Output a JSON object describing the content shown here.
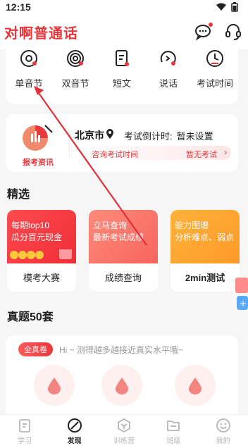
{
  "status_bar": {
    "time": "12:15"
  },
  "header": {
    "brand": "对啊普通话"
  },
  "categories": [
    {
      "label": "单音节",
      "icon": "single-syllable-icon"
    },
    {
      "label": "双音节",
      "icon": "double-syllable-icon"
    },
    {
      "label": "短文",
      "icon": "short-text-icon"
    },
    {
      "label": "说话",
      "icon": "speaking-icon"
    },
    {
      "label": "考试时间",
      "icon": "exam-time-icon"
    }
  ],
  "info_card": {
    "logo_caption": "报考资讯",
    "city": "北京市",
    "countdown_label": "考试倒计时:",
    "countdown_value": "暂未设置",
    "pill_left": "咨询考试时间",
    "pill_right": "暂无考试"
  },
  "featured": {
    "title": "精选",
    "cards": [
      {
        "top_line1": "每期top10",
        "top_line2": "瓜分百元现金",
        "label": "模考大赛"
      },
      {
        "top_line1": "立马查询",
        "top_line2": "最新考试成绩",
        "label": "成绩查询"
      },
      {
        "top_line1": "能力图谱",
        "top_line2": "分析难点、弱点",
        "label": "2min测试"
      }
    ]
  },
  "real_exams": {
    "title": "真题50套",
    "tag": "全真卷",
    "tagline": "Hi ~ 测得越多越接近真实水平哦~"
  },
  "bottom_nav": [
    {
      "label": "学习",
      "icon": "study-icon",
      "active": false
    },
    {
      "label": "发现",
      "icon": "discover-icon",
      "active": true
    },
    {
      "label": "训练营",
      "icon": "training-camp-icon",
      "active": false
    },
    {
      "label": "班级",
      "icon": "class-icon",
      "active": false
    },
    {
      "label": "我的",
      "icon": "profile-icon",
      "active": false
    }
  ],
  "colors": {
    "accent": "#e8383d",
    "background": "#f6f6f7",
    "annotation_arrow": "#e0313a"
  }
}
